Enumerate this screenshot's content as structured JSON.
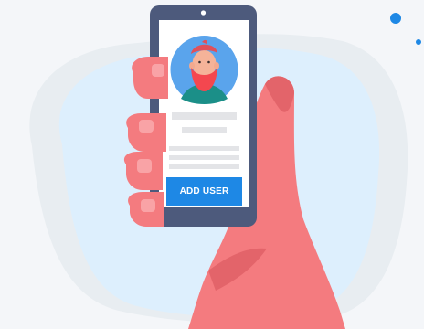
{
  "profile_card": {
    "add_user_button_label": "ADD USER"
  },
  "colors": {
    "background": "#f4f6f9",
    "blob": "#ddeffd",
    "phone_frame": "#4d5a7c",
    "screen": "#ffffff",
    "avatar_circle": "#5aa4ec",
    "beard": "#f4474f",
    "button": "#1e88e5",
    "skin": "#f47b7f",
    "accent_dots": "#1e88e5",
    "placeholder_lines": "#e3e4e7"
  },
  "icons": [
    "user-avatar-icon",
    "camera-dot-icon"
  ]
}
